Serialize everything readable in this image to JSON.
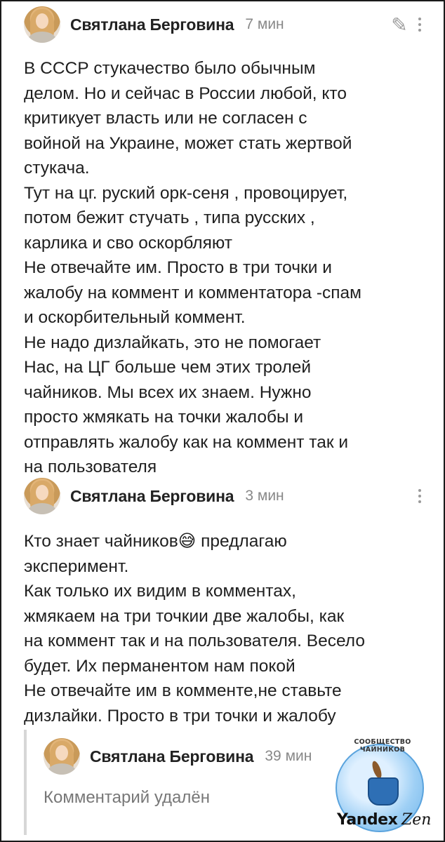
{
  "comments": [
    {
      "author": "Святлана Берговина",
      "time": "7 мин",
      "text": "В СССР стукачество было обычным\nделом. Но и сейчас в России любой, кто\nкритикует власть или не согласен с\nвойной на Украине, может стать жертвой\nстукача.\nТут на цг. руский орк-сеня , провоцирует,\nпотом бежит стучать , типа русских ,\nкарлика и сво оскорбляют\nНе отвечайте им. Просто в три точки и\nжалобу на коммент и комментатора -спам\nи оскорбительный коммент.\nНе надо дизлайкать, это не помогает\nНас, на ЦГ больше чем этих тролей\nчайников. Мы всех их знаем. Нужно\nпросто жмякать на точки жалобы и\nотправлять жалобу как на коммент так и\nна пользователя"
    },
    {
      "author": "Святлана Берговина",
      "time": "3 мин",
      "text": "Кто знает чайников😅 предлагаю\nэксперимент.\nКак только их видим в комментах,\nжмякаем на три точкии две жалобы, как\nна коммент так и на пользователя. Весело\nбудет. Их перманентом нам покой\nНе отвечайте им в комменте,не ставьте\nдизлайки. Просто в три точки и жалобу"
    }
  ],
  "reply": {
    "author": "Святлана Берговина",
    "time": "39 мин",
    "deleted_text": "Комментарий удалён"
  },
  "watermark": {
    "ring_text": "СООБЩЕСТВО ЧАЙНИКОВ",
    "brand_left": "Yandex",
    "brand_right": "Zen"
  },
  "icons": [
    "pencil-icon",
    "more-dots-icon"
  ]
}
